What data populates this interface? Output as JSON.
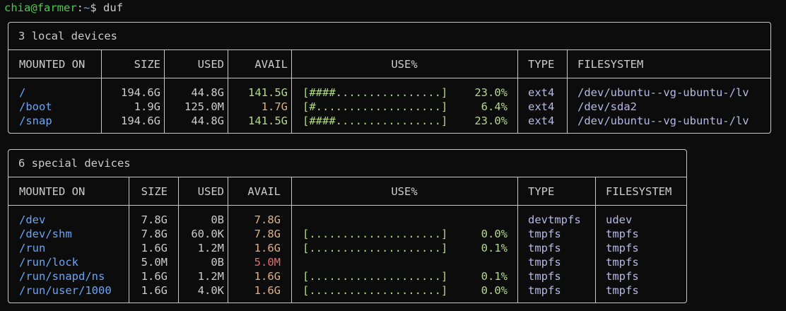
{
  "prompt": {
    "user_host": "chia@farmer",
    "sep": ":",
    "path": "~",
    "dollar": "$",
    "command": "duf"
  },
  "local": {
    "caption": "3 local devices",
    "headers": [
      "MOUNTED ON",
      "SIZE",
      "USED",
      "AVAIL",
      "USE%",
      "TYPE",
      "FILESYSTEM"
    ],
    "rows": [
      {
        "mount": "/",
        "size": "194.6G",
        "used": "44.8G",
        "avail": "141.5G",
        "avail_color": "green",
        "bar": "[####................]",
        "pct": "23.0%",
        "type": "ext4",
        "fs": "/dev/ubuntu--vg-ubuntu-/lv"
      },
      {
        "mount": "/boot",
        "size": "1.9G",
        "used": "125.0M",
        "avail": "1.7G",
        "avail_color": "orange",
        "bar": "[#...................]",
        "pct": "6.4%",
        "type": "ext4",
        "fs": "/dev/sda2"
      },
      {
        "mount": "/snap",
        "size": "194.6G",
        "used": "44.8G",
        "avail": "141.5G",
        "avail_color": "green",
        "bar": "[####................]",
        "pct": "23.0%",
        "type": "ext4",
        "fs": "/dev/ubuntu--vg-ubuntu-/lv"
      }
    ]
  },
  "special": {
    "caption": "6 special devices",
    "headers": [
      "MOUNTED ON",
      "SIZE",
      "USED",
      "AVAIL",
      "USE%",
      "TYPE",
      "FILESYSTEM"
    ],
    "rows": [
      {
        "mount": "/dev",
        "size": "7.8G",
        "used": "0B",
        "avail": "7.8G",
        "avail_color": "orange",
        "bar": "",
        "pct": "",
        "type": "devtmpfs",
        "fs": "udev"
      },
      {
        "mount": "/dev/shm",
        "size": "7.8G",
        "used": "60.0K",
        "avail": "7.8G",
        "avail_color": "orange",
        "bar": "[....................]",
        "pct": "0.0%",
        "type": "tmpfs",
        "fs": "tmpfs"
      },
      {
        "mount": "/run",
        "size": "1.6G",
        "used": "1.2M",
        "avail": "1.6G",
        "avail_color": "orange",
        "bar": "[....................]",
        "pct": "0.1%",
        "type": "tmpfs",
        "fs": "tmpfs"
      },
      {
        "mount": "/run/lock",
        "size": "5.0M",
        "used": "0B",
        "avail": "5.0M",
        "avail_color": "red",
        "bar": "",
        "pct": "",
        "type": "tmpfs",
        "fs": "tmpfs"
      },
      {
        "mount": "/run/snapd/ns",
        "size": "1.6G",
        "used": "1.2M",
        "avail": "1.6G",
        "avail_color": "orange",
        "bar": "[....................]",
        "pct": "0.1%",
        "type": "tmpfs",
        "fs": "tmpfs"
      },
      {
        "mount": "/run/user/1000",
        "size": "1.6G",
        "used": "4.0K",
        "avail": "1.6G",
        "avail_color": "orange",
        "bar": "[....................]",
        "pct": "0.0%",
        "type": "tmpfs",
        "fs": "tmpfs"
      }
    ]
  },
  "colors": {
    "green": "#b5d98a",
    "orange": "#e0b080",
    "red": "#e06c6c",
    "mount": "#6aa5f5",
    "border": "#c8c8c8",
    "background": "#0c0c0c"
  }
}
